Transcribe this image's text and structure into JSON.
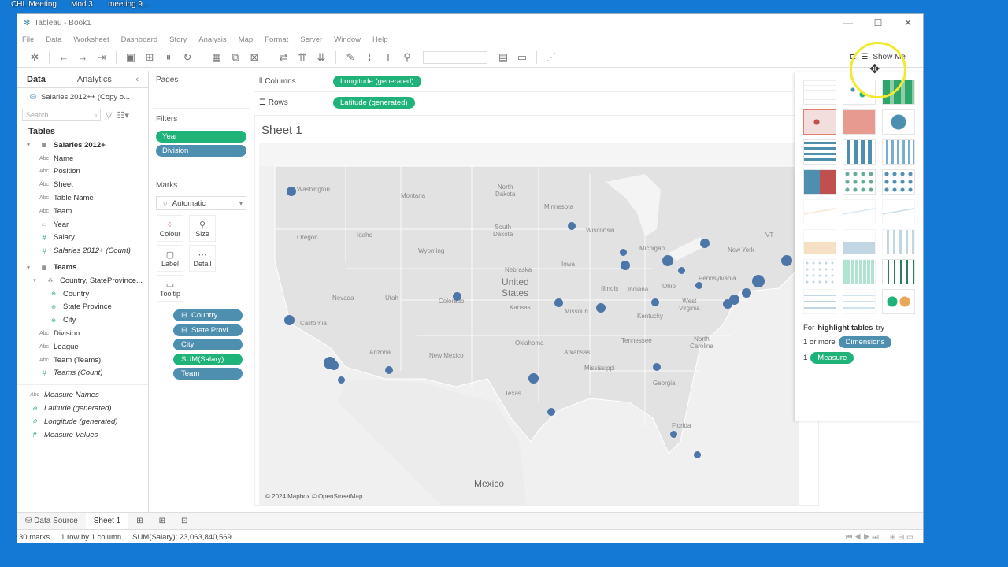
{
  "desktop": {
    "icons": [
      "CHL Meeting",
      "Mod 3",
      "meeting 9..."
    ]
  },
  "window": {
    "title": "Tableau - Book1",
    "controls": [
      "—",
      "☐",
      "✕"
    ]
  },
  "menu": [
    "File",
    "Data",
    "Worksheet",
    "Dashboard",
    "Story",
    "Analysis",
    "Map",
    "Format",
    "Server",
    "Window",
    "Help"
  ],
  "toolbar": {
    "show_me": "Show Me"
  },
  "data_pane": {
    "tabs": [
      "Data",
      "Analytics"
    ],
    "source": "Salaries 2012++ (Copy o...",
    "search_placeholder": "Search",
    "tables_header": "Tables",
    "groups": [
      {
        "name": "Salaries 2012+",
        "fields": [
          {
            "type": "Abc",
            "name": "Name"
          },
          {
            "type": "Abc",
            "name": "Position"
          },
          {
            "type": "Abc",
            "name": "Sheet"
          },
          {
            "type": "Abc",
            "name": "Table Name"
          },
          {
            "type": "Abc",
            "name": "Team"
          },
          {
            "type": "date",
            "name": "Year"
          },
          {
            "type": "#",
            "name": "Salary"
          },
          {
            "type": "#",
            "name": "Salaries 2012+ (Count)"
          }
        ]
      },
      {
        "name": "Teams",
        "fields": [
          {
            "type": "hier",
            "name": "Country, StateProvince..."
          },
          {
            "type": "geo",
            "name": "Country"
          },
          {
            "type": "geo",
            "name": "State Province"
          },
          {
            "type": "geo",
            "name": "City"
          },
          {
            "type": "Abc",
            "name": "Division"
          },
          {
            "type": "Abc",
            "name": "League"
          },
          {
            "type": "Abc",
            "name": "Team (Teams)"
          },
          {
            "type": "#",
            "name": "Teams (Count)"
          }
        ]
      }
    ],
    "extra_fields": [
      {
        "type": "Abc",
        "name": "Measure Names"
      },
      {
        "type": "geo",
        "name": "Latitude (generated)"
      },
      {
        "type": "geo",
        "name": "Longitude (generated)"
      },
      {
        "type": "#",
        "name": "Measure Values"
      }
    ]
  },
  "pages_label": "Pages",
  "filters": {
    "label": "Filters",
    "items": [
      "Year",
      "Division"
    ]
  },
  "marks": {
    "label": "Marks",
    "type": "Automatic",
    "buttons": [
      "Colour",
      "Size",
      "Label",
      "Detail",
      "Tooltip"
    ],
    "pills": [
      "Country",
      "State Provi...",
      "City",
      "SUM(Salary)",
      "Team"
    ]
  },
  "shelves": {
    "columns_label": "Columns",
    "columns_pill": "Longitude (generated)",
    "rows_label": "Rows",
    "rows_pill": "Latitude (generated)"
  },
  "sheet": {
    "title": "Sheet 1",
    "copyright": "© 2024 Mapbox © OpenStreetMap",
    "map_labels": {
      "washington": "Washington",
      "montana": "Montana",
      "north_dakota": "North\nDakota",
      "minnesota": "Minnesota",
      "oregon": "Oregon",
      "idaho": "Idaho",
      "south_dakota": "South\nDakota",
      "wisconsin": "Wisconsin",
      "michigan": "Michigan",
      "wyoming": "Wyoming",
      "nebraska": "Nebraska",
      "iowa": "Iowa",
      "vt": "VT",
      "new_york": "New York",
      "united_states": "United\nStates",
      "nevada": "Nevada",
      "utah": "Utah",
      "colorado": "Colorado",
      "kansas": "Kansas",
      "illinois": "Illinois",
      "indiana": "Indiana",
      "ohio": "Ohio",
      "pennsylvania": "Pennsylvania",
      "california": "California",
      "missouri": "Missouri",
      "west_virginia": "West\nVirginia",
      "kentucky": "Kentucky",
      "oklahoma": "Oklahoma",
      "tennessee": "Tennessee",
      "north_carolina": "North\nCarolina",
      "arizona": "Arizona",
      "new_mexico": "New Mexico",
      "arkansas": "Arkansas",
      "mississippi": "Mississippi",
      "georgia": "Georgia",
      "texas": "Texas",
      "florida": "Florida",
      "mexico": "Mexico"
    }
  },
  "show_me": {
    "hint_prefix": "For ",
    "hint_bold": "highlight tables",
    "hint_suffix": " try",
    "req1_prefix": "1 or more",
    "req1_pill": "Dimensions",
    "req2_prefix": "1",
    "req2_pill": "Measure"
  },
  "sheet_tabs": {
    "data_source": "Data Source",
    "sheet1": "Sheet 1"
  },
  "status": {
    "marks": "30 marks",
    "rows_cols": "1 row  by  1 column",
    "sum": "SUM(Salary): 23,063,840,569"
  },
  "colors": {
    "dimension_pill": "#4e8fb0",
    "measure_pill": "#1fb37a",
    "map_dot": "#4c75a8",
    "desktop": "#1479d4"
  }
}
